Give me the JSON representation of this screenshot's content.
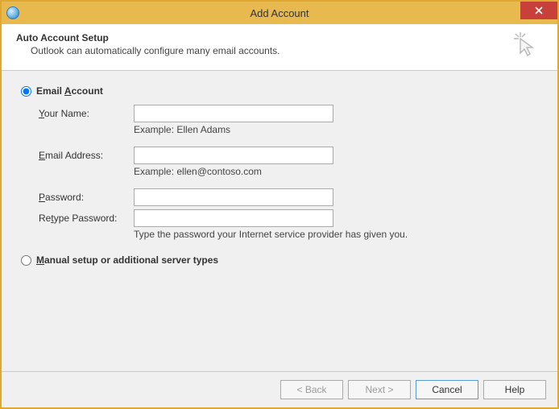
{
  "window": {
    "title": "Add Account"
  },
  "header": {
    "title": "Auto Account Setup",
    "subtitle": "Outlook can automatically configure many email accounts."
  },
  "options": {
    "email_account_label": "Email Account",
    "manual_setup_label": "Manual setup or additional server types"
  },
  "fields": {
    "your_name_label": "Your Name:",
    "your_name_value": "",
    "your_name_hint": "Example: Ellen Adams",
    "email_label": "Email Address:",
    "email_value": "",
    "email_hint": "Example: ellen@contoso.com",
    "password_label": "Password:",
    "password_value": "",
    "retype_label": "Retype Password:",
    "retype_value": "",
    "password_hint": "Type the password your Internet service provider has given you."
  },
  "buttons": {
    "back": "< Back",
    "next": "Next >",
    "cancel": "Cancel",
    "help": "Help"
  }
}
